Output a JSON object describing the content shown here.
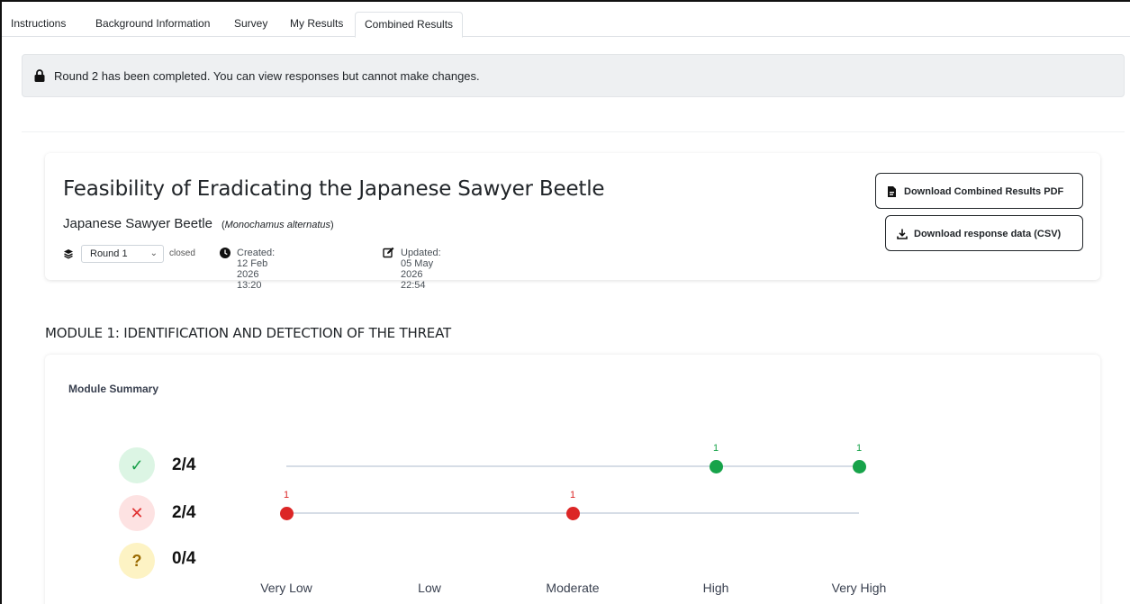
{
  "tabs": [
    {
      "label": "Instructions",
      "active": false
    },
    {
      "label": "Background Information",
      "active": false
    },
    {
      "label": "Survey",
      "active": false
    },
    {
      "label": "My Results",
      "active": false
    },
    {
      "label": "Combined Results",
      "active": true
    }
  ],
  "alert": {
    "icon": "lock-icon",
    "message": "Round 2 has been completed. You can view responses but cannot make changes."
  },
  "header": {
    "title": "Feasibility of Eradicating the Japanese Sawyer Beetle",
    "common_name": "Japanese Sawyer Beetle",
    "scientific_name": "(Monochamus alternatus)",
    "round_select": {
      "value": "Round 1"
    },
    "round_status": "closed",
    "created": "Created: 12 Feb 2026 13:20",
    "updated": "Updated: 05 May 2026 22:54",
    "download_pdf_label": "Download Combined Results PDF",
    "download_csv_label": "Download response data (CSV)"
  },
  "module": {
    "heading": "MODULE 1: IDENTIFICATION AND DETECTION OF THE THREAT",
    "summary_label": "Module Summary",
    "counts": [
      {
        "kind": "yes",
        "icon": "check-icon",
        "value": "2/4",
        "color": "#1aa04b",
        "bg": "#dcf5e4"
      },
      {
        "kind": "no",
        "icon": "cross-icon",
        "value": "2/4",
        "color": "#e03131",
        "bg": "#fde2e2"
      },
      {
        "kind": "unsure",
        "icon": "question-icon",
        "value": "0/4",
        "color": "#9a6a00",
        "bg": "#fdf3c4"
      }
    ],
    "scale": [
      "Very Low",
      "Low",
      "Moderate",
      "High",
      "Very High"
    ]
  },
  "chart_data": {
    "type": "scatter",
    "categories": [
      "Very Low",
      "Low",
      "Moderate",
      "High",
      "Very High"
    ],
    "series": [
      {
        "kind": "yes",
        "color": "#17a34a",
        "points": [
          {
            "category": "High",
            "count": 1
          },
          {
            "category": "Very High",
            "count": 1
          }
        ]
      },
      {
        "kind": "no",
        "color": "#dc2626",
        "points": [
          {
            "category": "Very Low",
            "count": 1
          },
          {
            "category": "Moderate",
            "count": 1
          }
        ]
      }
    ]
  }
}
